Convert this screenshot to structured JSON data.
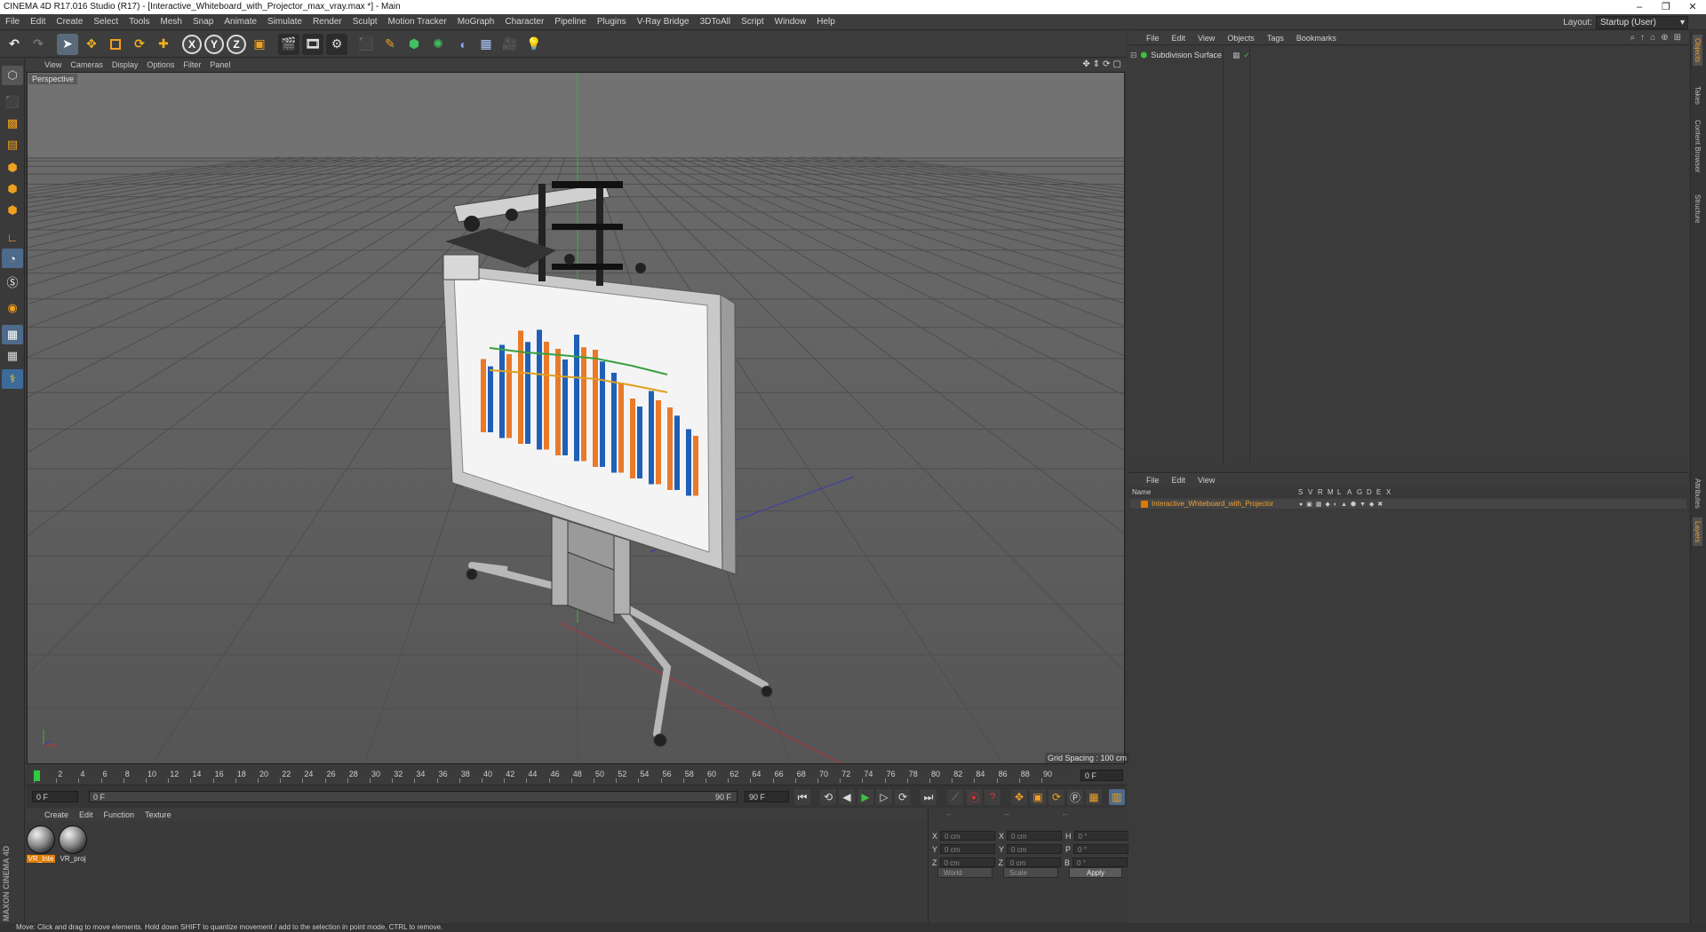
{
  "window": {
    "title": "CINEMA 4D R17.016 Studio (R17) - [Interactive_Whiteboard_with_Projector_max_vray.max *] - Main",
    "min": "–",
    "max": "❐",
    "close": "✕"
  },
  "menubar": {
    "items": [
      "File",
      "Edit",
      "Create",
      "Select",
      "Tools",
      "Mesh",
      "Snap",
      "Animate",
      "Simulate",
      "Render",
      "Sculpt",
      "Motion Tracker",
      "MoGraph",
      "Character",
      "Pipeline",
      "Plugins",
      "V-Ray Bridge",
      "3DToAll",
      "Script",
      "Window",
      "Help"
    ],
    "layout_label": "Layout:",
    "layout_value": "Startup (User)"
  },
  "toolbar": {
    "undo": "↶",
    "redo": "↷",
    "axis_x": "X",
    "axis_y": "Y",
    "axis_z": "Z"
  },
  "viewport": {
    "menu": [
      "View",
      "Cameras",
      "Display",
      "Options",
      "Filter",
      "Panel"
    ],
    "label": "Perspective",
    "grid_spacing": "Grid Spacing : 100 cm",
    "nav_icons": [
      "✥",
      "⇕",
      "⟳",
      "▢"
    ]
  },
  "timeline": {
    "ticks": [
      "0",
      "2",
      "4",
      "6",
      "8",
      "10",
      "12",
      "14",
      "16",
      "18",
      "20",
      "22",
      "24",
      "26",
      "28",
      "30",
      "32",
      "34",
      "36",
      "38",
      "40",
      "42",
      "44",
      "46",
      "48",
      "50",
      "52",
      "54",
      "56",
      "58",
      "60",
      "62",
      "64",
      "66",
      "68",
      "70",
      "72",
      "74",
      "76",
      "78",
      "80",
      "82",
      "84",
      "86",
      "88",
      "90"
    ],
    "current_frame": "0 F",
    "start_field": "0 F",
    "range_start": "0 F",
    "range_end": "90 F",
    "end_field": "90 F"
  },
  "materials": {
    "menu": [
      "Create",
      "Edit",
      "Function",
      "Texture"
    ],
    "items": [
      {
        "label": "VR_Inte",
        "active": true
      },
      {
        "label": "VR_proj",
        "active": false
      }
    ]
  },
  "coordinates": {
    "header": [
      "--",
      "--",
      "--"
    ],
    "rows": [
      {
        "a": "X",
        "av": "0 cm",
        "b": "X",
        "bv": "0 cm",
        "c": "H",
        "cv": "0 °"
      },
      {
        "a": "Y",
        "av": "0 cm",
        "b": "Y",
        "bv": "0 cm",
        "c": "P",
        "cv": "0 °"
      },
      {
        "a": "Z",
        "av": "0 cm",
        "b": "Z",
        "bv": "0 cm",
        "c": "B",
        "cv": "0 °"
      }
    ],
    "mode1": "World",
    "mode2": "Scale",
    "apply": "Apply"
  },
  "objects": {
    "menu": [
      "File",
      "Edit",
      "View",
      "Objects",
      "Tags",
      "Bookmarks"
    ],
    "items": [
      {
        "name": "Subdivision Surface"
      }
    ]
  },
  "layers": {
    "menu": [
      "File",
      "Edit",
      "View"
    ],
    "header_name": "Name",
    "header_flags": [
      "S",
      "V",
      "R",
      "M",
      "L",
      "A",
      "G",
      "D",
      "E",
      "X"
    ],
    "rows": [
      {
        "name": "Interactive_Whiteboard_with_Projector",
        "color": "#e07a00"
      }
    ]
  },
  "right_tabs": [
    "Objects",
    "Takes",
    "Content Browser",
    "Structure",
    "Attributes",
    "Layers"
  ],
  "status": "Move: Click and drag to move elements. Hold down SHIFT to quantize movement / add to the selection in point mode, CTRL to remove.",
  "branding": "MAXON CINEMA 4D",
  "colors": {
    "accent": "#e07a00",
    "chart_blue": "#1f5fb8",
    "chart_orange": "#e87a2a"
  }
}
